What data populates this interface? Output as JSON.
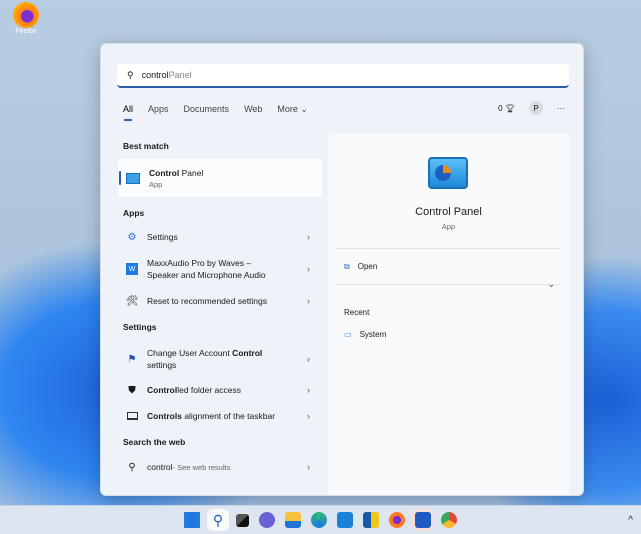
{
  "desktop": {
    "icons": [
      {
        "label": "Firefox",
        "icon": "firefox-icon"
      }
    ]
  },
  "search": {
    "typed": "control",
    "suggestion": " Panel"
  },
  "tabs": [
    {
      "label": "All",
      "active": true
    },
    {
      "label": "Apps"
    },
    {
      "label": "Documents"
    },
    {
      "label": "Web"
    },
    {
      "label": "More ⌄"
    }
  ],
  "toolbar": {
    "points": "0",
    "avatar": "P",
    "more": "···"
  },
  "sections": {
    "best_match": "Best match",
    "apps": "Apps",
    "settings": "Settings",
    "web": "Search the web"
  },
  "best_match": {
    "title_bold": "Control",
    "title_rest": " Panel",
    "sub": "App"
  },
  "apps": [
    {
      "text": "Settings",
      "icon": "settings-gear-icon"
    },
    {
      "text": "MaxxAudio Pro by Waves –",
      "text2": "Speaker and Microphone Audio",
      "icon": "maxxaudio-icon"
    },
    {
      "text": "Reset to recommended settings",
      "icon": "tools-icon"
    }
  ],
  "settings": [
    {
      "pre": "Change User Account ",
      "bold": "Control",
      "post": "",
      "line2": "settings",
      "icon": "uac-flag-icon"
    },
    {
      "pre": "",
      "bold": "Control",
      "post": "led folder access",
      "icon": "shield-icon"
    },
    {
      "pre": "",
      "bold": "Controls",
      "post": " alignment of the taskbar",
      "icon": "taskbar-icon"
    }
  ],
  "web": {
    "query": "control",
    "hint": " - See web results"
  },
  "detail": {
    "title": "Control Panel",
    "sub": "App",
    "open": "Open",
    "recent": "Recent",
    "recent_items": [
      "System"
    ]
  },
  "taskbar": {
    "icons": [
      "start",
      "search",
      "task-view",
      "teams-chat",
      "file-explorer",
      "edge",
      "mail",
      "power-bi",
      "firefox",
      "word",
      "chrome"
    ],
    "tray": "^"
  }
}
